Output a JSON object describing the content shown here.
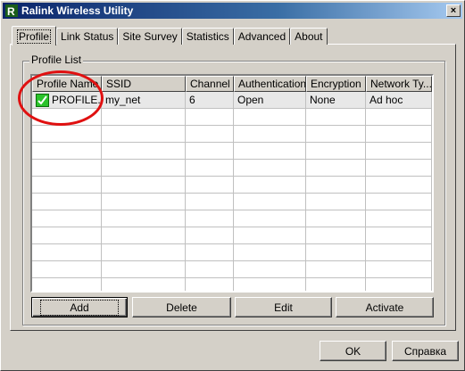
{
  "window": {
    "title": "Ralink Wireless Utility",
    "close_label": "×",
    "accent": "#0a246a"
  },
  "tabs": [
    {
      "label": "Profile",
      "active": true
    },
    {
      "label": "Link Status"
    },
    {
      "label": "Site Survey"
    },
    {
      "label": "Statistics"
    },
    {
      "label": "Advanced"
    },
    {
      "label": "About"
    }
  ],
  "profile_list": {
    "group_label": "Profile List",
    "columns": [
      "Profile Name",
      "SSID",
      "Channel",
      "Authentication",
      "Encryption",
      "Network Ty..."
    ],
    "rows": [
      {
        "profile_name": "PROFILE...",
        "ssid": "my_net",
        "channel": "6",
        "authentication": "Open",
        "encryption": "None",
        "network_type": "Ad hoc",
        "active": true
      }
    ]
  },
  "actions": {
    "add": "Add",
    "delete": "Delete",
    "edit": "Edit",
    "activate": "Activate"
  },
  "footer": {
    "ok": "OK",
    "help": "Справка"
  },
  "icons": {
    "app": "ralink-icon",
    "active_profile": "check-icon"
  }
}
